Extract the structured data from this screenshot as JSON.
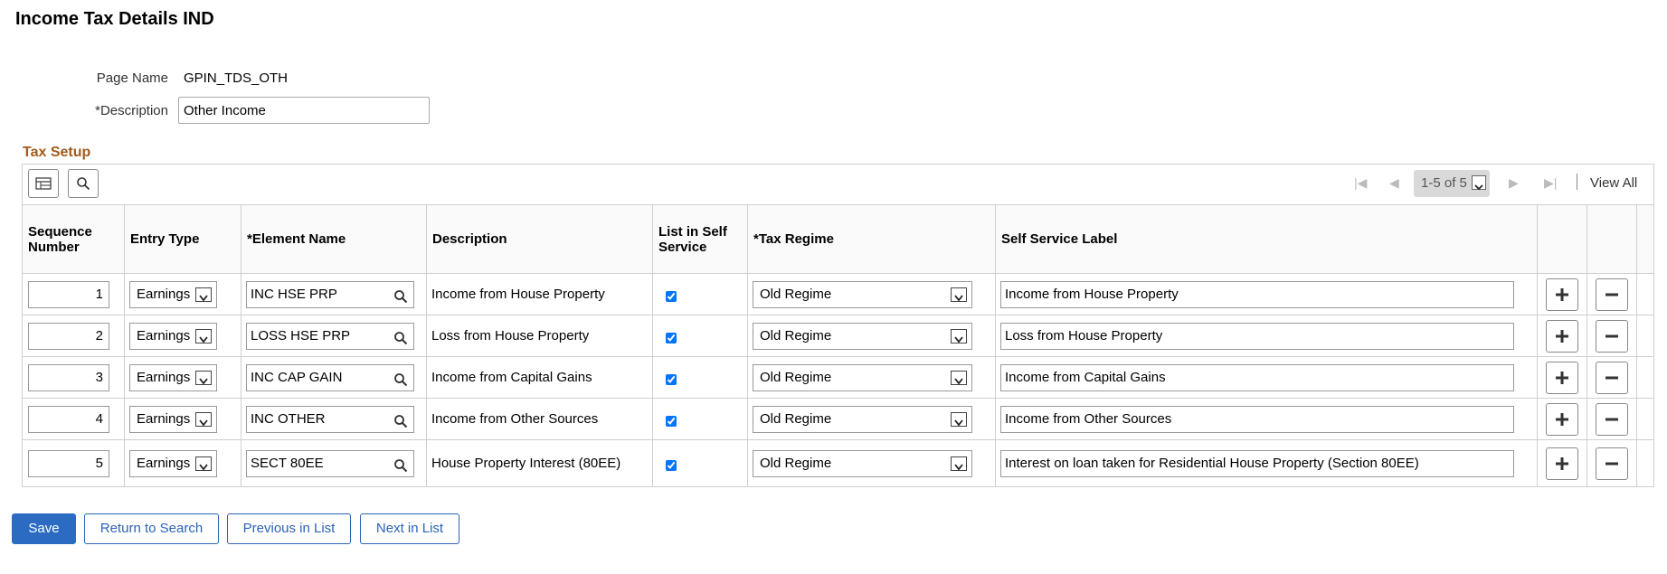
{
  "page": {
    "title": "Income Tax Details IND",
    "page_name_label": "Page Name",
    "page_name_value": "GPIN_TDS_OTH",
    "description_label": "*Description",
    "description_value": "Other Income"
  },
  "tax_setup": {
    "title": "Tax Setup",
    "range": "1-5 of 5",
    "view_all": "View All",
    "columns": [
      "Sequence Number",
      "Entry Type",
      "*Element Name",
      "Description",
      "List in Self Service",
      "*Tax Regime",
      "Self Service Label"
    ],
    "rows": [
      {
        "seq": "1",
        "entry_type": "Earnings",
        "element": "INC HSE PRP",
        "description": "Income from House Property",
        "self_service": true,
        "regime": "Old Regime",
        "label": "Income from House Property"
      },
      {
        "seq": "2",
        "entry_type": "Earnings",
        "element": "LOSS HSE PRP",
        "description": "Loss from House Property",
        "self_service": true,
        "regime": "Old Regime",
        "label": "Loss from House Property"
      },
      {
        "seq": "3",
        "entry_type": "Earnings",
        "element": "INC CAP GAIN",
        "description": "Income from Capital Gains",
        "self_service": true,
        "regime": "Old Regime",
        "label": "Income from Capital Gains"
      },
      {
        "seq": "4",
        "entry_type": "Earnings",
        "element": "INC OTHER",
        "description": "Income from Other Sources",
        "self_service": true,
        "regime": "Old Regime",
        "label": "Income from Other Sources"
      },
      {
        "seq": "5",
        "entry_type": "Earnings",
        "element": "SECT 80EE",
        "description": "House Property Interest (80EE)",
        "self_service": true,
        "regime": "Old Regime",
        "label": "Interest on loan taken for Residential House Property (Section 80EE)"
      }
    ]
  },
  "buttons": {
    "save": "Save",
    "return_to_search": "Return to Search",
    "previous_in_list": "Previous in List",
    "next_in_list": "Next in List"
  },
  "colors": {
    "section_title": "#a35a1a",
    "primary_button": "#2b6bc2",
    "link_blue": "#2a63b5"
  }
}
